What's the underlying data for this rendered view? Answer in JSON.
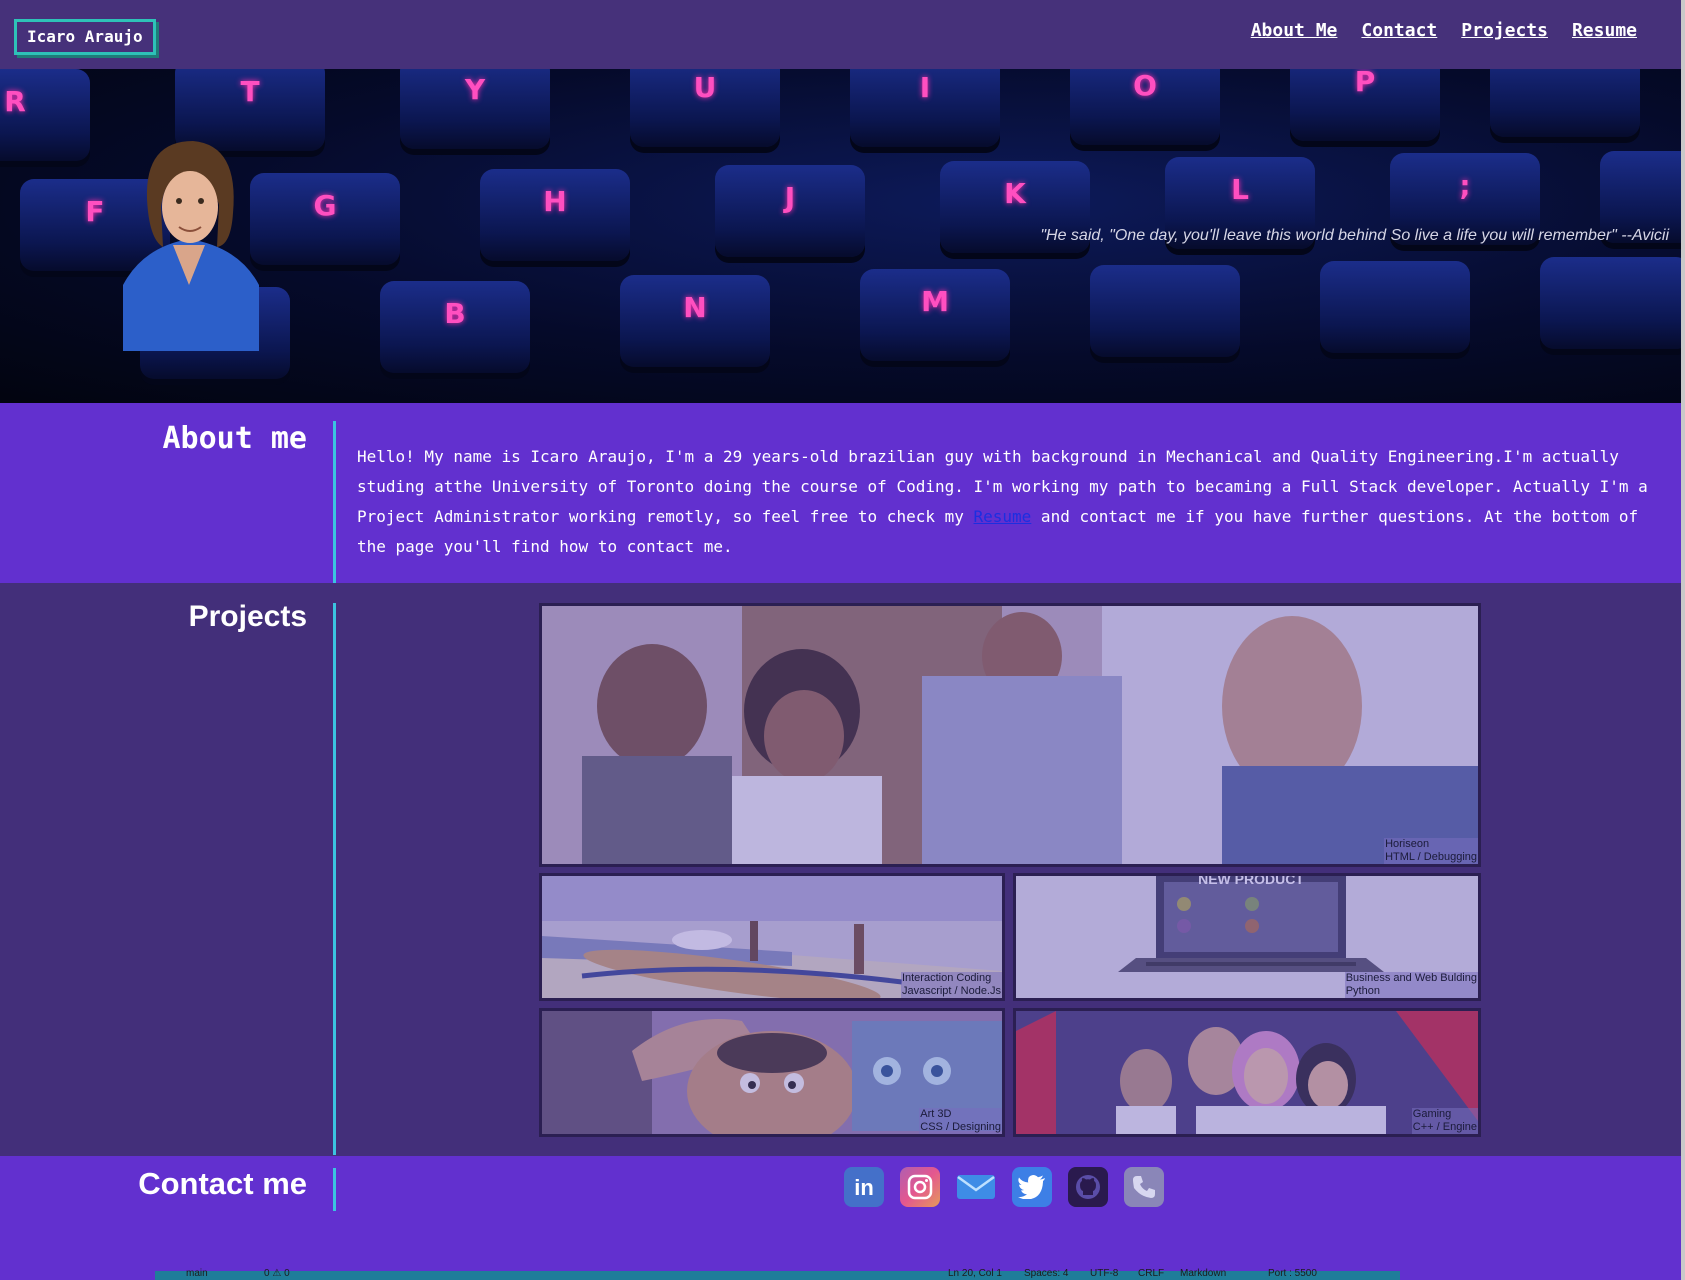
{
  "header": {
    "logo": "Icaro Araujo",
    "nav": [
      "About Me",
      "Contact",
      "Projects",
      "Resume"
    ]
  },
  "hero": {
    "keys": [
      "R",
      "T",
      "Y",
      "U",
      "I",
      "O",
      "P",
      "F",
      "G",
      "H",
      "J",
      "K",
      "L",
      ";",
      "B",
      "N",
      "M"
    ],
    "quote": "\"He said, \"One day, you'll leave this world behind So live a life you will remember\" --Avicii"
  },
  "about": {
    "title": "About me",
    "text_before": "Hello! My name is Icaro Araujo, I'm a 29 years-old brazilian guy with background in Mechanical and Quality Engineering.I'm actually studing atthe University of Toronto doing the course of Coding. I'm working my path to becaming a Full Stack developer. Actually I'm a Project Administrator working remotly, so feel free to check my ",
    "link": "Resume",
    "text_after": " and contact me if you have further questions. At the bottom of the page you'll find how to contact me."
  },
  "projects": {
    "title": "Projects",
    "items": [
      {
        "name": "Horiseon",
        "tech": "HTML / Debugging"
      },
      {
        "name": "Interaction Coding",
        "tech": "Javascript / Node.Js"
      },
      {
        "name": "Business and Web Bulding",
        "tech": "Python"
      },
      {
        "name": "Art 3D",
        "tech": "CSS / Designing"
      },
      {
        "name": "Gaming",
        "tech": "C++ / Engine"
      }
    ],
    "screen_text": "NEW PRODUCT"
  },
  "contact": {
    "title": "Contact me",
    "icons": [
      "linkedin-icon",
      "instagram-icon",
      "email-icon",
      "twitter-icon",
      "github-icon",
      "phone-icon"
    ]
  },
  "statusbar": {
    "branch": "main",
    "errors": "0 ⚠ 0",
    "position": "Ln 20, Col 1",
    "spaces": "Spaces: 4",
    "encoding": "UTF-8",
    "eol": "CRLF",
    "language": "Markdown",
    "port": "Port : 5500"
  }
}
